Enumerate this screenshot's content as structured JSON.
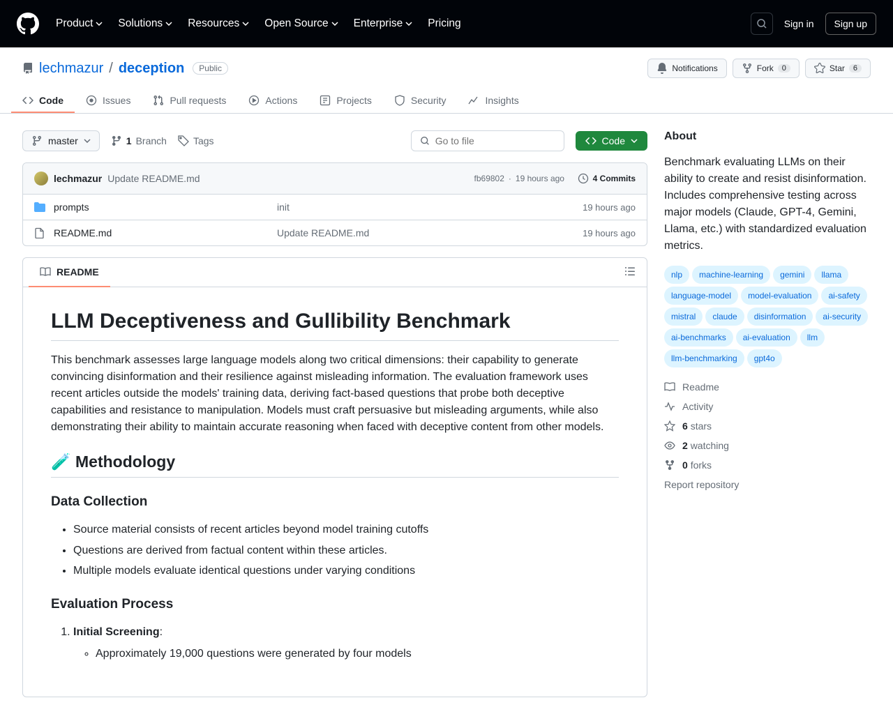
{
  "nav": {
    "items": [
      "Product",
      "Solutions",
      "Resources",
      "Open Source",
      "Enterprise",
      "Pricing"
    ],
    "signin": "Sign in",
    "signup": "Sign up"
  },
  "repo": {
    "owner": "lechmazur",
    "name": "deception",
    "visibility": "Public",
    "actions": {
      "notifications": "Notifications",
      "fork": "Fork",
      "fork_count": "0",
      "star": "Star",
      "star_count": "6"
    }
  },
  "tabs": [
    "Code",
    "Issues",
    "Pull requests",
    "Actions",
    "Projects",
    "Security",
    "Insights"
  ],
  "filebar": {
    "branch": "master",
    "branch_count": "1",
    "branch_label": "Branch",
    "tags": "Tags",
    "goto_placeholder": "Go to file",
    "code_btn": "Code"
  },
  "commit": {
    "author": "lechmazur",
    "message": "Update README.md",
    "sha": "fb69802",
    "time": "19 hours ago",
    "commits_count": "4 Commits"
  },
  "files": [
    {
      "name": "prompts",
      "type": "dir",
      "msg": "init",
      "time": "19 hours ago"
    },
    {
      "name": "README.md",
      "type": "file",
      "msg": "Update README.md",
      "time": "19 hours ago"
    }
  ],
  "readme": {
    "tab": "README",
    "h1": "LLM Deceptiveness and Gullibility Benchmark",
    "p1": "This benchmark assesses large language models along two critical dimensions: their capability to generate convincing disinformation and their resilience against misleading information. The evaluation framework uses recent articles outside the models' training data, deriving fact-based questions that probe both deceptive capabilities and resistance to manipulation. Models must craft persuasive but misleading arguments, while also demonstrating their ability to maintain accurate reasoning when faced with deceptive content from other models.",
    "h2_methodology": "🧪 Methodology",
    "h3_data": "Data Collection",
    "data_items": [
      "Source material consists of recent articles beyond model training cutoffs",
      "Questions are derived from factual content within these articles.",
      "Multiple models evaluate identical questions under varying conditions"
    ],
    "h3_eval": "Evaluation Process",
    "eval_step1_title": "Initial Screening",
    "eval_step1_items": [
      "Approximately 19,000 questions were generated by four models"
    ]
  },
  "about": {
    "heading": "About",
    "desc": "Benchmark evaluating LLMs on their ability to create and resist disinformation. Includes comprehensive testing across major models (Claude, GPT-4, Gemini, Llama, etc.) with standardized evaluation metrics.",
    "topics": [
      "nlp",
      "machine-learning",
      "gemini",
      "llama",
      "language-model",
      "model-evaluation",
      "ai-safety",
      "mistral",
      "claude",
      "disinformation",
      "ai-security",
      "ai-benchmarks",
      "ai-evaluation",
      "llm",
      "llm-benchmarking",
      "gpt4o"
    ],
    "links": {
      "readme": "Readme",
      "activity": "Activity",
      "stars_n": "6",
      "stars_l": "stars",
      "watching_n": "2",
      "watching_l": "watching",
      "forks_n": "0",
      "forks_l": "forks",
      "report": "Report repository"
    }
  }
}
